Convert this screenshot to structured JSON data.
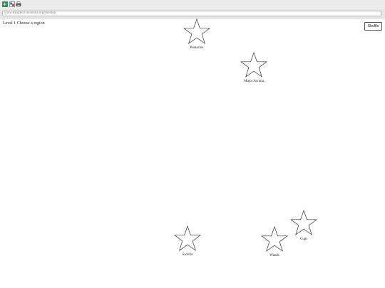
{
  "address_bar": {
    "url": "www.daugl63t.nouslina.org/desktop"
  },
  "game": {
    "level_text": "Level 1   Choose a region",
    "shuffle_label": "Shuffle",
    "regions": [
      {
        "label": "Pentacles"
      },
      {
        "label": "Major Arcana"
      },
      {
        "label": "Cups"
      },
      {
        "label": "Swords"
      },
      {
        "label": "Wands"
      }
    ]
  },
  "icons": {
    "toolbar": [
      "back-arrow-icon",
      "translate-icon",
      "print-icon"
    ],
    "region": "star-outline-icon"
  },
  "colors": {
    "toolbar_bg": "#ececec",
    "star_stroke": "#333333"
  }
}
